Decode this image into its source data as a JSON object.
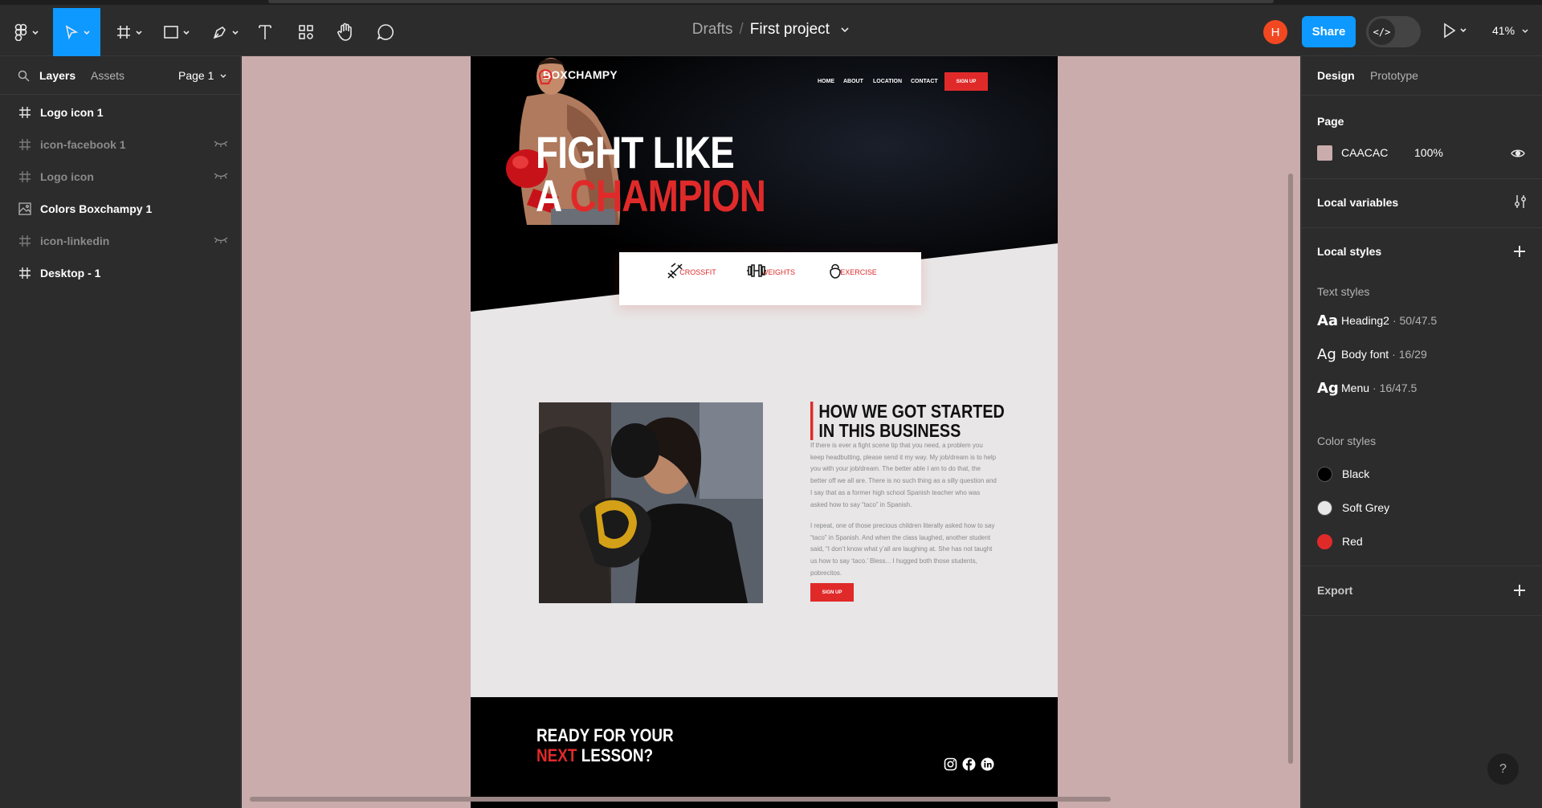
{
  "toolbar": {
    "breadcrumb_root": "Drafts",
    "breadcrumb_separator": "/",
    "project_name": "First project",
    "user_initial": "H",
    "share_label": "Share",
    "dev_mode_glyph": "</>",
    "zoom": "41%",
    "tools": [
      "figma-menu-icon",
      "move-icon",
      "frame-icon",
      "rectangle-icon",
      "pen-icon",
      "text-icon",
      "resources-icon",
      "hand-icon",
      "comment-icon"
    ]
  },
  "left_panel": {
    "tab_layers": "Layers",
    "tab_assets": "Assets",
    "page_label": "Page 1",
    "layers": [
      {
        "name": "Logo icon 1",
        "hidden": false,
        "type": "frame"
      },
      {
        "name": "icon-facebook 1",
        "hidden": true,
        "type": "frame"
      },
      {
        "name": "Logo icon",
        "hidden": true,
        "type": "frame"
      },
      {
        "name": "Colors Boxchampy 1",
        "hidden": false,
        "type": "image"
      },
      {
        "name": "icon-linkedin",
        "hidden": true,
        "type": "frame"
      },
      {
        "name": "Desktop - 1",
        "hidden": false,
        "type": "frame"
      }
    ]
  },
  "design": {
    "brand": "BOXCHAMPY",
    "nav": [
      "HOME",
      "ABOUT",
      "LOCATION",
      "CONTACT"
    ],
    "signup": "SIGN UP",
    "headline_line1": "FIGHT LIKE",
    "headline_a": "A",
    "headline_red": "CHAMPION",
    "services": [
      "CROSSFIT",
      "WEIGHTS",
      "EXERCISE"
    ],
    "about_title_line1": "HOW WE GOT STARTED",
    "about_title_line2": "IN THIS BUSINESS",
    "about_p1": "If there is ever a fight scene tip that you need, a problem you keep headbutting, please send it my way. My job/dream is to help you with your job/dream. The better able I am to do that, the better off we all are. There is no such thing as a silly question and I say that as a former high school Spanish teacher who was asked how to say “taco” in Spanish.",
    "about_p2": " I repeat, one of those precious children literally asked how to say “taco” in Spanish. And when the class laughed, another student said, “I don’t know what y’all are laughing at. She has not taught us how to say ‘taco.’ Bless... I hugged both those students, pobrecitos.",
    "cta_line1": "READY FOR YOUR",
    "cta_next": "NEXT",
    "cta_lesson": "LESSON?",
    "colors": {
      "accent": "#e02a2a",
      "dark": "#000000",
      "light": "#e8e6e6"
    }
  },
  "right_panel": {
    "tab_design": "Design",
    "tab_prototype": "Prototype",
    "page_section": "Page",
    "page_color": "CAACAC",
    "page_opacity": "100%",
    "local_variables": "Local variables",
    "local_styles": "Local styles",
    "text_styles_label": "Text styles",
    "text_styles": [
      {
        "glyph": "Aa",
        "name": "Heading2",
        "meta": "· 50/47.5"
      },
      {
        "glyph": "Ag",
        "name": "Body font",
        "meta": "· 16/29"
      },
      {
        "glyph": "Ag",
        "name": "Menu",
        "meta": "· 16/47.5"
      }
    ],
    "color_styles_label": "Color styles",
    "color_styles": [
      {
        "name": "Black",
        "hex": "#000000"
      },
      {
        "name": "Soft Grey",
        "hex": "#e8e8e8"
      },
      {
        "name": "Red",
        "hex": "#e02a2a"
      }
    ],
    "export": "Export",
    "help": "?"
  },
  "canvas": {
    "background": "#caacac"
  }
}
